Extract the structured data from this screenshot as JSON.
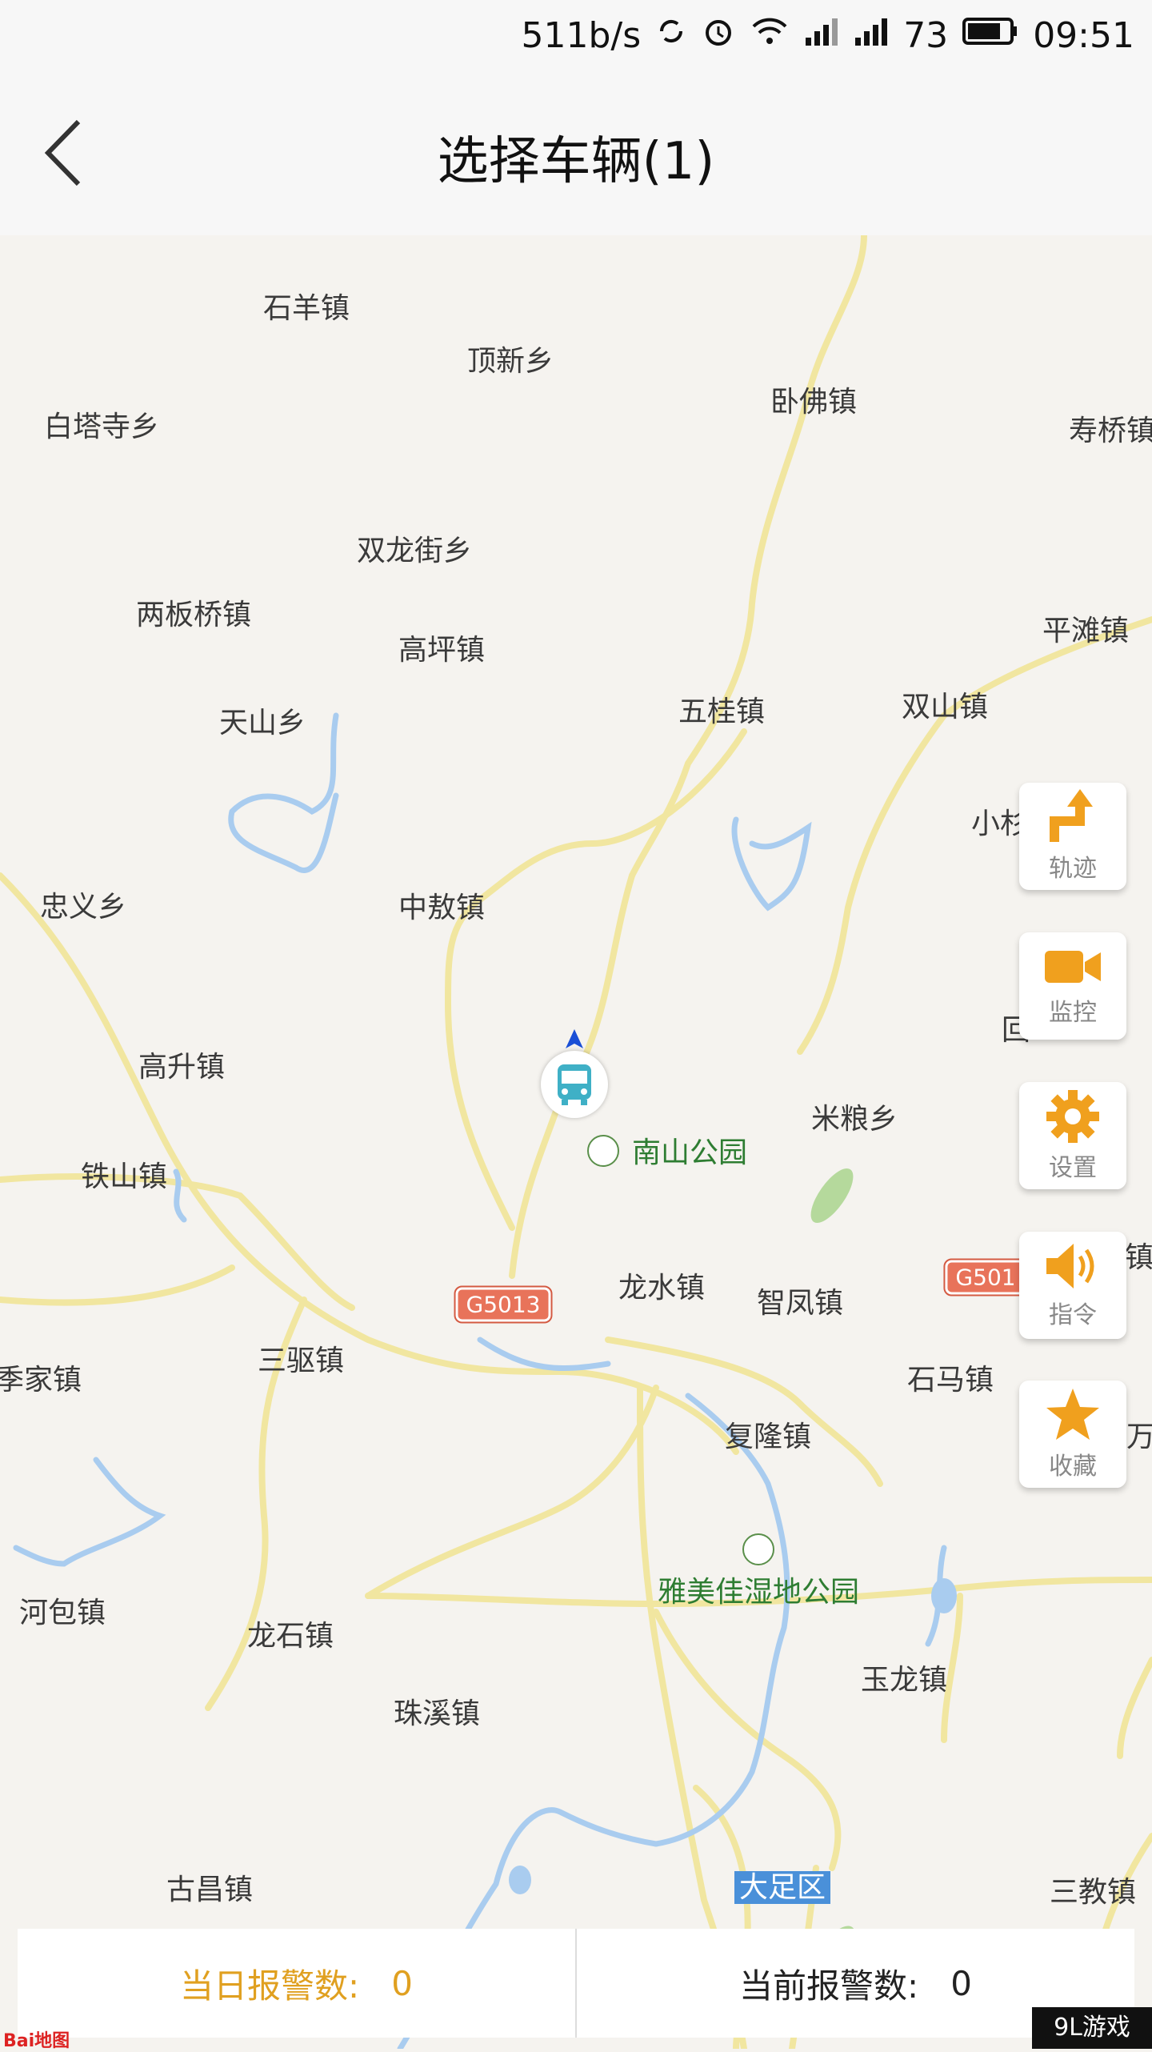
{
  "status_bar": {
    "net_speed": "511b/s",
    "battery_level": "73",
    "time": "09:51",
    "icons": [
      "sync-icon",
      "alarm-icon",
      "wifi-icon",
      "signal-icon",
      "signal-icon",
      "battery-icon"
    ]
  },
  "header": {
    "title": "选择车辆(1)",
    "back_icon": "chevron-left-icon"
  },
  "map": {
    "places": [
      {
        "name": "石羊镇",
        "kind": "town"
      },
      {
        "name": "顶新乡",
        "kind": "town"
      },
      {
        "name": "卧佛镇",
        "kind": "town"
      },
      {
        "name": "寿桥镇",
        "kind": "town"
      },
      {
        "name": "白塔寺乡",
        "kind": "town"
      },
      {
        "name": "双龙街乡",
        "kind": "town"
      },
      {
        "name": "两板桥镇",
        "kind": "town"
      },
      {
        "name": "高坪镇",
        "kind": "town"
      },
      {
        "name": "平滩镇",
        "kind": "town"
      },
      {
        "name": "天山乡",
        "kind": "town"
      },
      {
        "name": "五桂镇",
        "kind": "town"
      },
      {
        "name": "双山镇",
        "kind": "town"
      },
      {
        "name": "小杉",
        "kind": "town"
      },
      {
        "name": "忠义乡",
        "kind": "town"
      },
      {
        "name": "中敖镇",
        "kind": "town"
      },
      {
        "name": "高升镇",
        "kind": "town"
      },
      {
        "name": "回",
        "kind": "town"
      },
      {
        "name": "米粮乡",
        "kind": "town"
      },
      {
        "name": "南山公园",
        "kind": "poi"
      },
      {
        "name": "铁山镇",
        "kind": "town"
      },
      {
        "name": "镇",
        "kind": "town"
      },
      {
        "name": "龙水镇",
        "kind": "town"
      },
      {
        "name": "智凤镇",
        "kind": "town"
      },
      {
        "name": "三驱镇",
        "kind": "town"
      },
      {
        "name": "季家镇",
        "kind": "town"
      },
      {
        "name": "石马镇",
        "kind": "town"
      },
      {
        "name": "复隆镇",
        "kind": "town"
      },
      {
        "name": "万",
        "kind": "town"
      },
      {
        "name": "雅美佳湿地公园",
        "kind": "poi"
      },
      {
        "name": "河包镇",
        "kind": "town"
      },
      {
        "name": "龙石镇",
        "kind": "town"
      },
      {
        "name": "玉龙镇",
        "kind": "town"
      },
      {
        "name": "珠溪镇",
        "kind": "town"
      },
      {
        "name": "古昌镇",
        "kind": "town"
      },
      {
        "name": "大足区",
        "kind": "district"
      },
      {
        "name": "三教镇",
        "kind": "town"
      }
    ],
    "highway_shields": [
      "G5013",
      "G501"
    ],
    "vehicle_marker": "bus-icon",
    "logo_text": "Bai地图"
  },
  "side_buttons": [
    {
      "label": "轨迹",
      "icon": "route-arrow-icon",
      "color": "#f0a01e"
    },
    {
      "label": "监控",
      "icon": "video-camera-icon",
      "color": "#f0a01e"
    },
    {
      "label": "设置",
      "icon": "gear-icon",
      "color": "#f0a01e"
    },
    {
      "label": "指令",
      "icon": "speaker-icon",
      "color": "#f0a01e"
    },
    {
      "label": "收藏",
      "icon": "star-icon",
      "color": "#f0a01e"
    }
  ],
  "bottom_bar": {
    "today_alarms_label": "当日报警数:",
    "today_alarms_value": "0",
    "current_alarms_label": "当前报警数:",
    "current_alarms_value": "0"
  },
  "watermark": "9L游戏",
  "colors": {
    "accent": "#f0a01e",
    "road": "#f3e9a0",
    "water": "#a9ccef",
    "shield": "#e8735a"
  }
}
